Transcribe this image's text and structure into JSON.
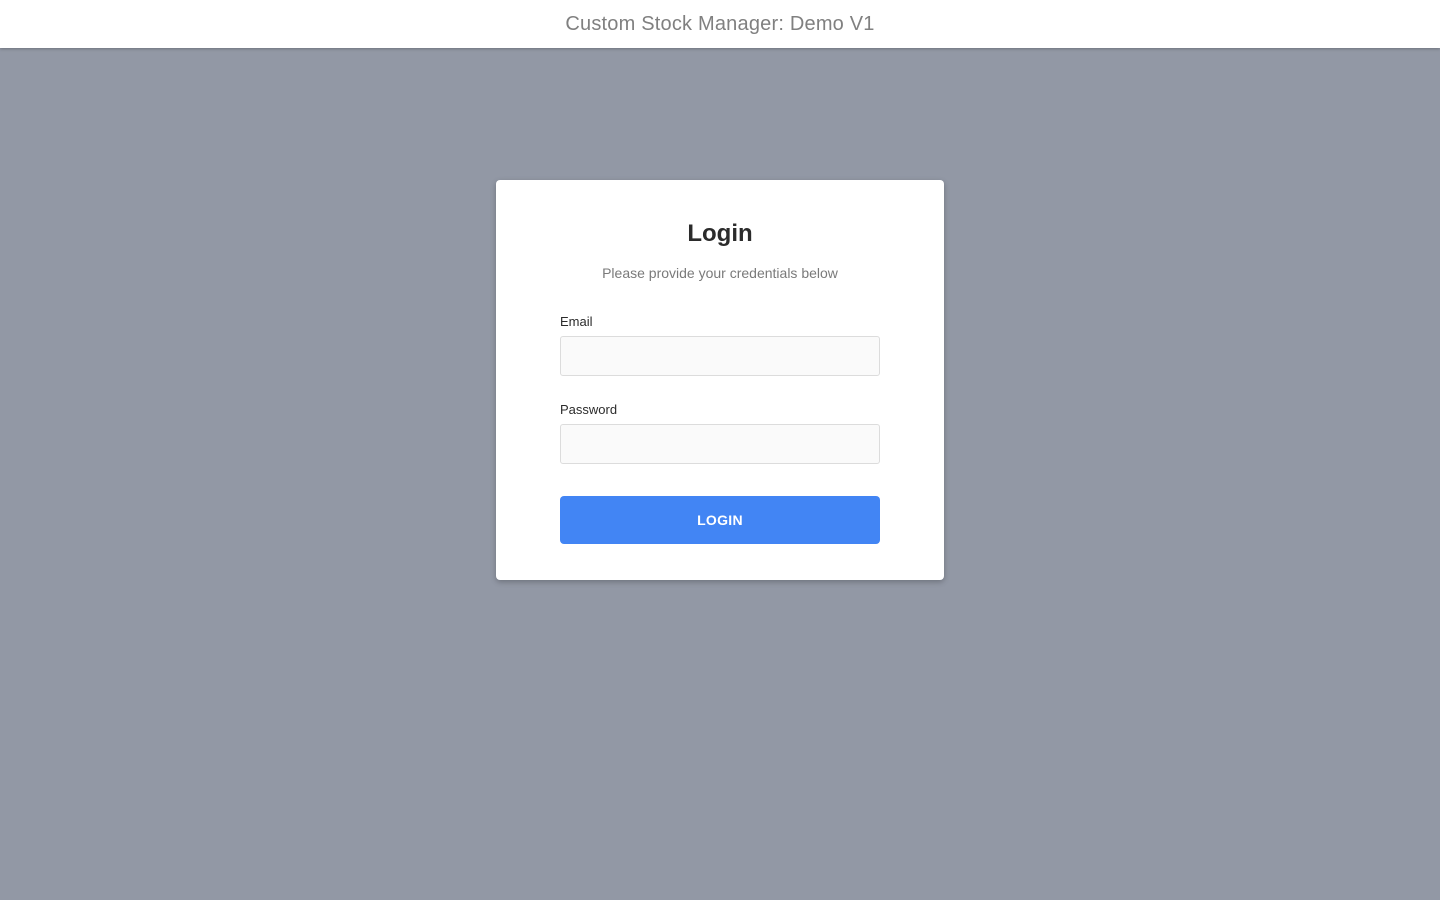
{
  "app": {
    "title": "Custom Stock Manager: Demo V1"
  },
  "login": {
    "heading": "Login",
    "subtitle": "Please provide your credentials below",
    "email": {
      "label": "Email",
      "value": "",
      "placeholder": ""
    },
    "password": {
      "label": "Password",
      "value": "",
      "placeholder": ""
    },
    "submit_label": "LOGIN"
  },
  "colors": {
    "page_background": "#9298a5",
    "card_background": "#ffffff",
    "primary_button": "#4285f4",
    "header_text": "#808080"
  }
}
